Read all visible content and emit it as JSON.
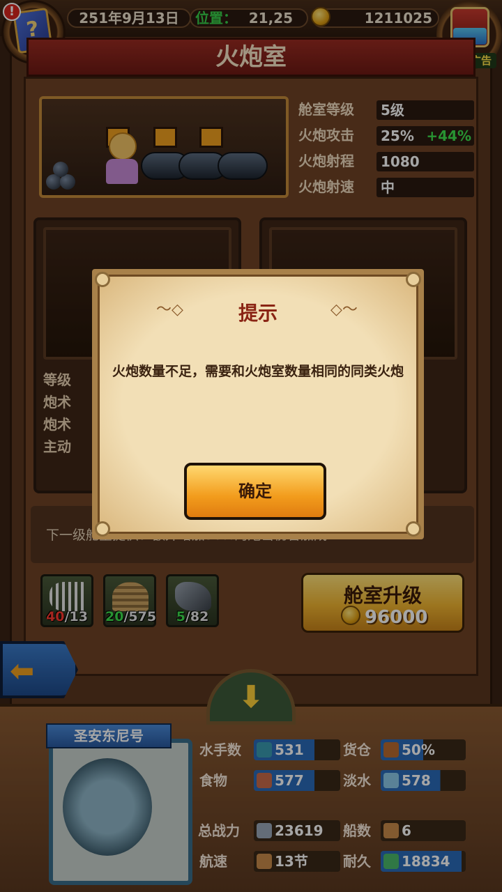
{
  "topbar": {
    "date": "251年9月13日",
    "position_label": "位置：",
    "position_value": "21,25",
    "gold": "1211025",
    "alert_icon": "exclamation-icon",
    "no_ad_label": "暂无广告"
  },
  "room": {
    "title": "火炮室",
    "stats": [
      {
        "label": "舱室等级",
        "value": "5级",
        "bonus": ""
      },
      {
        "label": "火炮攻击",
        "value": "25%",
        "bonus": "+44%"
      },
      {
        "label": "火炮射程",
        "value": "1080",
        "bonus": ""
      },
      {
        "label": "火炮射速",
        "value": "中",
        "bonus": ""
      }
    ],
    "card_labels": [
      "等级",
      "炮术",
      "炮术",
      "主动"
    ],
    "hint_text": "下一级舱室提供：额外增加30%的炮击伤害加成"
  },
  "materials": [
    {
      "icon": "fish-bone-icon",
      "have": "40",
      "need": "/13",
      "status": "insufficient"
    },
    {
      "icon": "rope-coil-icon",
      "have": "20",
      "need": "/575",
      "status": "sufficient"
    },
    {
      "icon": "iron-nail-icon",
      "have": "5",
      "need": "/82",
      "status": "sufficient"
    }
  ],
  "upgrade": {
    "label": "舱室升级",
    "cost": "96000"
  },
  "ship": {
    "name": "圣安东尼号",
    "stats": {
      "sailors_label": "水手数",
      "sailors": "531",
      "cargo_label": "货仓",
      "cargo": "50%",
      "food_label": "食物",
      "food": "577",
      "water_label": "淡水",
      "water": "578",
      "power_label": "总战力",
      "power": "23619",
      "ships_label": "船数",
      "ships": "6",
      "speed_label": "航速",
      "speed": "13节",
      "durability_label": "耐久",
      "durability": "18834"
    }
  },
  "dialog": {
    "title": "提示",
    "message": "火炮数量不足，需要和火炮室数量相同的同类火炮",
    "confirm_label": "确定"
  },
  "colors": {
    "title_red": "#8a2414",
    "bonus_green": "#3ee04e",
    "position_green": "#38d14a",
    "have_insufficient": "#ff3b30",
    "button_orange": "#f29c1c"
  }
}
